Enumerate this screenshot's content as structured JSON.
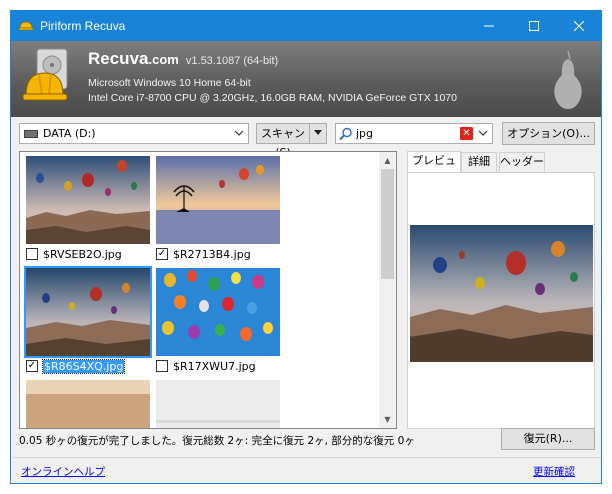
{
  "window": {
    "title": "Piriform Recuva"
  },
  "header": {
    "brand_name": "Recuva",
    "brand_tld": ".com",
    "version": "v1.53.1087 (64-bit)",
    "os_line": "Microsoft Windows 10 Home 64-bit",
    "hw_line": "Intel Core i7-8700 CPU @ 3.20GHz, 16.0GB RAM, NVIDIA GeForce GTX 1070"
  },
  "toolbar": {
    "drive": "DATA (D:)",
    "scan_label": "スキャン(S)",
    "search_value": "jpg",
    "options_label": "オプション(O)..."
  },
  "files": [
    {
      "name": "$RVSEB2O.jpg",
      "checked": false,
      "selected": false
    },
    {
      "name": "$R2713B4.jpg",
      "checked": true,
      "selected": false
    },
    {
      "name": "$R86S4XQ.jpg",
      "checked": true,
      "selected": true
    },
    {
      "name": "$R17XWU7.jpg",
      "checked": false,
      "selected": false
    }
  ],
  "preview": {
    "tabs": [
      "プレビュー",
      "詳細",
      "ヘッダー"
    ],
    "active_tab": 0
  },
  "status": {
    "text": "0.05 秒ヶの復元が完了しました。復元総数 2ヶ: 完全に復元 2ヶ, 部分的な復元 0ヶ",
    "recover_label": "復元(R)..."
  },
  "footer": {
    "help_link": "オンラインヘルプ",
    "update_link": "更新確認"
  },
  "colors": {
    "titlebar": "#1883d7",
    "selection": "#3399ff",
    "link": "#0000ee",
    "clear_red": "#e0231b"
  }
}
